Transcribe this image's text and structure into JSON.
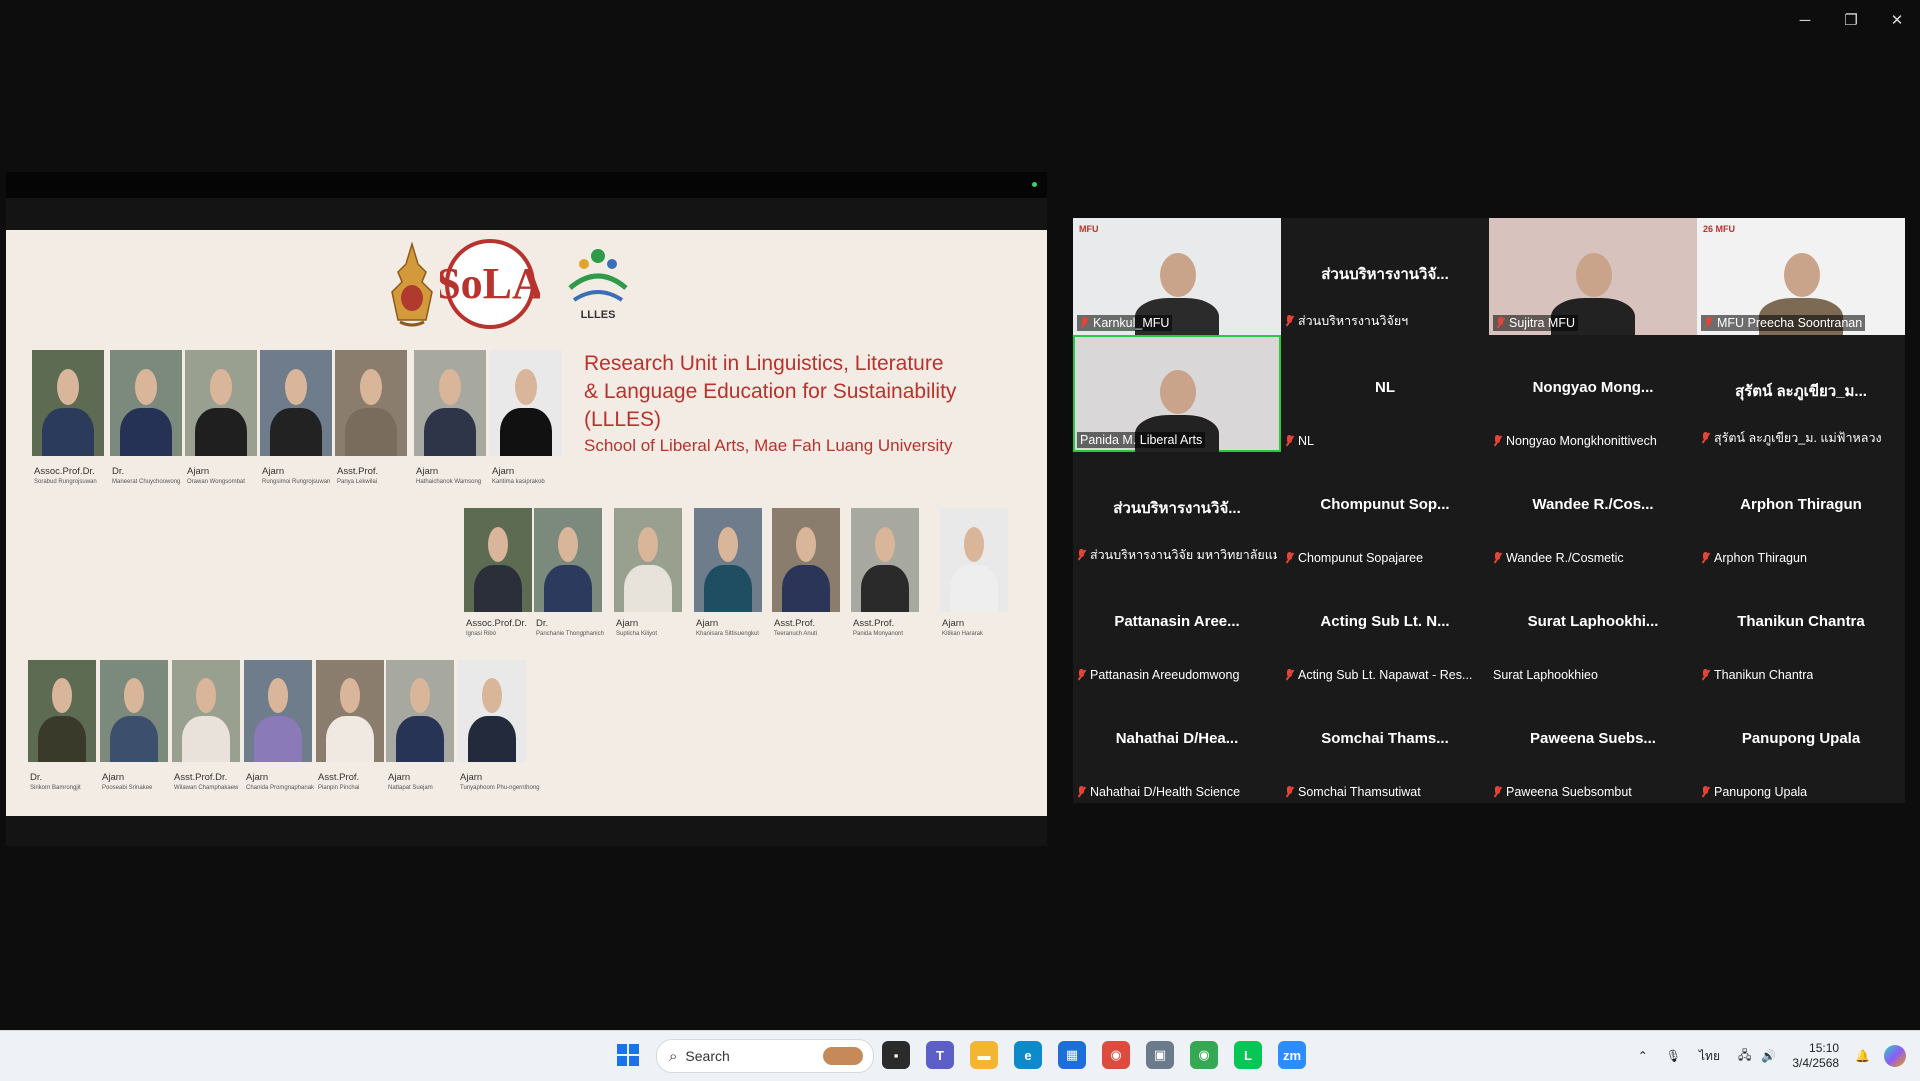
{
  "window_controls": {
    "minimize": "─",
    "restore": "❐",
    "close": "✕"
  },
  "slide": {
    "heading_line1": "Research Unit in Linguistics, Literature",
    "heading_line2": "& Language Education for Sustainability",
    "heading_line3": "(LLLES)",
    "subheading": "School of Liberal Arts, Mae Fah Luang University",
    "logo_sola": "SoLA",
    "logo_llles": "LLLES",
    "row1": [
      {
        "title": "Assoc.Prof.Dr.",
        "name": "Sorabud Rungrojsuwan",
        "torso": "#2b3b5c"
      },
      {
        "title": "Dr.",
        "name": "Maneerat Chuychoowong",
        "torso": "#253155"
      },
      {
        "title": "Ajarn",
        "name": "Orawan Wongsombat",
        "torso": "#1f1f1f"
      },
      {
        "title": "Ajarn",
        "name": "Rungsimoi Rungrojsuwan",
        "torso": "#222222"
      },
      {
        "title": "Asst.Prof.",
        "name": "Panya Lekwilai",
        "torso": "#7a6c5c"
      },
      {
        "title": "Ajarn",
        "name": "Hathaichanok Wamsong",
        "torso": "#2e3548"
      },
      {
        "title": "Ajarn",
        "name": "Kantima kasiprakob",
        "torso": "#111111"
      }
    ],
    "row2": [
      {
        "title": "Assoc.Prof.Dr.",
        "name": "Ignasi Ribó",
        "torso": "#2b2f3a"
      },
      {
        "title": "Dr.",
        "name": "Panchanie Thongphanich",
        "torso": "#2c3a5e"
      },
      {
        "title": "Ajarn",
        "name": "Supticha Kiliyot",
        "torso": "#e7e2da"
      },
      {
        "title": "Ajarn",
        "name": "Khanisara Sittisuengkul",
        "torso": "#1f4e63"
      },
      {
        "title": "Asst.Prof.",
        "name": "Teeranuch Anuti",
        "torso": "#2a3557"
      },
      {
        "title": "Asst.Prof.",
        "name": "Panida Monyanont",
        "torso": "#2a2a2a"
      },
      {
        "title": "Ajarn",
        "name": "Kitikan Hararak",
        "torso": "#eeeeee"
      }
    ],
    "row3": [
      {
        "title": "Dr.",
        "name": "Sirikorn Bamrongjit",
        "torso": "#3a3a2a"
      },
      {
        "title": "Ajarn",
        "name": "Pooseabi Srinakee",
        "torso": "#3c4f6c"
      },
      {
        "title": "Asst.Prof.Dr.",
        "name": "Wilawan Champhakaew",
        "torso": "#e8e2da"
      },
      {
        "title": "Ajarn",
        "name": "Chanida Promgnaphanak",
        "torso": "#8a7ab8"
      },
      {
        "title": "Asst.Prof.",
        "name": "Pianpin Pinchai",
        "torso": "#efe9e1"
      },
      {
        "title": "Ajarn",
        "name": "Nattapat Suejam",
        "torso": "#273455"
      },
      {
        "title": "Ajarn",
        "name": "Tunyaphoom Phu-ngernthong",
        "torso": "#222a3c"
      }
    ]
  },
  "gallery": [
    {
      "big": "",
      "label": "Karnkul_MFU",
      "muted": true,
      "video": true,
      "bgc": "#e9eaec",
      "torso": "#2b2b2b",
      "logo": "MFU"
    },
    {
      "big": "ส่วนบริหารงานวิจั...",
      "label": "ส่วนบริหารงานวิจัยฯ",
      "muted": true,
      "video": false
    },
    {
      "big": "",
      "label": "Sujitra MFU",
      "muted": true,
      "video": true,
      "bgc": "#d8c2bd",
      "torso": "#222222",
      "logo": ""
    },
    {
      "big": "",
      "label": "MFU Preecha Soontranan",
      "muted": true,
      "video": true,
      "bgc": "#f2f2f2",
      "torso": "#7d6a55",
      "logo": "26 MFU"
    },
    {
      "big": "",
      "label": "Panida M. Liberal Arts",
      "muted": false,
      "video": true,
      "bgc": "#dad7d8",
      "torso": "#222222",
      "logo": "",
      "active": true
    },
    {
      "big": "NL",
      "label": "NL",
      "muted": true,
      "video": false
    },
    {
      "big": "Nongyao  Mong...",
      "label": "Nongyao Mongkhonittivech",
      "muted": true,
      "video": false
    },
    {
      "big": "สุรัตน์ ละภูเขียว_ม...",
      "label": "สุรัตน์ ละภูเขียว_ม. แม่ฟ้าหลวง",
      "muted": true,
      "video": false
    },
    {
      "big": "ส่วนบริหารงานวิจั...",
      "label": "ส่วนบริหารงานวิจัย มหาวิทยาลัยแม่...",
      "muted": true,
      "video": false
    },
    {
      "big": "Chompunut  Sop...",
      "label": "Chompunut Sopajaree",
      "muted": true,
      "video": false
    },
    {
      "big": "Wandee  R./Cos...",
      "label": "Wandee R./Cosmetic",
      "muted": true,
      "video": false
    },
    {
      "big": "Arphon Thiragun",
      "label": "Arphon Thiragun",
      "muted": true,
      "video": false
    },
    {
      "big": "Pattanasin  Aree...",
      "label": "Pattanasin Areeudomwong",
      "muted": true,
      "video": false
    },
    {
      "big": "Acting Sub Lt. N...",
      "label": "Acting Sub Lt. Napawat - Res...",
      "muted": true,
      "video": false
    },
    {
      "big": "Surat  Laphookhi...",
      "label": "Surat Laphookhieo",
      "muted": false,
      "video": false
    },
    {
      "big": "Thanikun Chantra",
      "label": "Thanikun Chantra",
      "muted": true,
      "video": false
    },
    {
      "big": "Nahathai  D/Hea...",
      "label": "Nahathai D/Health Science",
      "muted": true,
      "video": false
    },
    {
      "big": "Somchai  Thams...",
      "label": "Somchai Thamsutiwat",
      "muted": true,
      "video": false
    },
    {
      "big": "Paweena  Suebs...",
      "label": "Paweena Suebsombut",
      "muted": true,
      "video": false
    },
    {
      "big": "Panupong Upala",
      "label": "Panupong Upala",
      "muted": true,
      "video": false
    }
  ],
  "taskbar": {
    "search_label": "Search",
    "lang": "ไทย",
    "time": "15:10",
    "date": "3/4/2568",
    "apps": [
      {
        "name": "teams-icon",
        "color": "#5b5fc7",
        "glyph": "T"
      },
      {
        "name": "file-explorer-icon",
        "color": "#f2b632",
        "glyph": "▬"
      },
      {
        "name": "edge-icon",
        "color": "#0c8ac9",
        "glyph": "e"
      },
      {
        "name": "store-icon",
        "color": "#1b6fd6",
        "glyph": "▦"
      },
      {
        "name": "chrome-icon",
        "color": "#dd4b3e",
        "glyph": "◉"
      },
      {
        "name": "photos-icon",
        "color": "#6b7b8c",
        "glyph": "▣"
      },
      {
        "name": "chrome-profile-icon",
        "color": "#34a853",
        "glyph": "◉"
      },
      {
        "name": "line-icon",
        "color": "#06c755",
        "glyph": "L"
      },
      {
        "name": "zoom-icon",
        "color": "#2d8cff",
        "glyph": "zm"
      }
    ]
  }
}
